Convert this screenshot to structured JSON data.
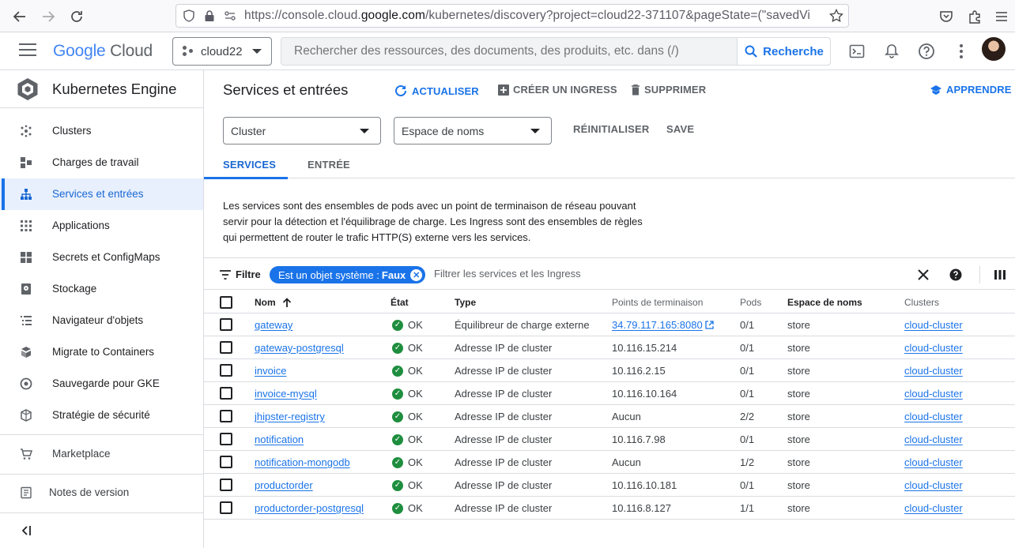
{
  "browser": {
    "url_prefix": "https://console.cloud.",
    "url_domain": "google.com",
    "url_rest": "/kubernetes/discovery?project=cloud22-371107&pageState=(\"savedVi"
  },
  "header": {
    "logo_google": "Google",
    "logo_cloud": "Cloud",
    "project": "cloud22",
    "search_placeholder": "Rechercher des ressources, des documents, des produits, etc. dans (/)",
    "search_button": "Recherche"
  },
  "sidebar": {
    "product": "Kubernetes Engine",
    "items": [
      {
        "label": "Clusters",
        "icon": "clusters-icon"
      },
      {
        "label": "Charges de travail",
        "icon": "workloads-icon"
      },
      {
        "label": "Services et entrées",
        "icon": "services-icon"
      },
      {
        "label": "Applications",
        "icon": "applications-icon"
      },
      {
        "label": "Secrets et ConfigMaps",
        "icon": "secrets-icon"
      },
      {
        "label": "Stockage",
        "icon": "storage-icon"
      },
      {
        "label": "Navigateur d'objets",
        "icon": "object-browser-icon"
      },
      {
        "label": "Migrate to Containers",
        "icon": "migrate-icon"
      },
      {
        "label": "Sauvegarde pour GKE",
        "icon": "backup-icon"
      },
      {
        "label": "Stratégie de sécurité",
        "icon": "security-icon"
      }
    ],
    "marketplace": "Marketplace",
    "release_notes": "Notes de version",
    "collapse": "<|"
  },
  "main": {
    "title": "Services et entrées",
    "refresh": "ACTUALISER",
    "create_ingress": "CRÉER UN INGRESS",
    "delete": "SUPPRIMER",
    "learn": "APPRENDRE",
    "cluster_dropdown": "Cluster",
    "namespace_dropdown": "Espace de noms",
    "reset": "RÉINITIALISER",
    "save": "SAVE",
    "tabs": [
      "SERVICES",
      "ENTRÉE"
    ],
    "description": "Les services sont des ensembles de pods avec un point de terminaison de réseau pouvant servir pour la détection et l'équilibrage de charge. Les Ingress sont des ensembles de règles qui permettent de router le trafic HTTP(S) externe vers les services.",
    "filter_label": "Filtre",
    "chip_key": "Est un objet système :",
    "chip_value": "Faux",
    "filter_placeholder": "Filtrer les services et les Ingress"
  },
  "table": {
    "columns": [
      "Nom",
      "État",
      "Type",
      "Points de terminaison",
      "Pods",
      "Espace de noms",
      "Clusters"
    ],
    "rows": [
      {
        "name": "gateway",
        "status": "OK",
        "type": "Équilibreur de charge externe",
        "endpoints": "34.79.117.165:8080",
        "pods": "0/1",
        "namespace": "store",
        "cluster": "cloud-cluster"
      },
      {
        "name": "gateway-postgresql",
        "status": "OK",
        "type": "Adresse IP de cluster",
        "endpoints": "10.116.15.214",
        "pods": "0/1",
        "namespace": "store",
        "cluster": "cloud-cluster"
      },
      {
        "name": "invoice",
        "status": "OK",
        "type": "Adresse IP de cluster",
        "endpoints": "10.116.2.15",
        "pods": "0/1",
        "namespace": "store",
        "cluster": "cloud-cluster"
      },
      {
        "name": "invoice-mysql",
        "status": "OK",
        "type": "Adresse IP de cluster",
        "endpoints": "10.116.10.164",
        "pods": "0/1",
        "namespace": "store",
        "cluster": "cloud-cluster"
      },
      {
        "name": "jhipster-registry",
        "status": "OK",
        "type": "Adresse IP de cluster",
        "endpoints": "Aucun",
        "pods": "2/2",
        "namespace": "store",
        "cluster": "cloud-cluster"
      },
      {
        "name": "notification",
        "status": "OK",
        "type": "Adresse IP de cluster",
        "endpoints": "10.116.7.98",
        "pods": "0/1",
        "namespace": "store",
        "cluster": "cloud-cluster"
      },
      {
        "name": "notification-mongodb",
        "status": "OK",
        "type": "Adresse IP de cluster",
        "endpoints": "Aucun",
        "pods": "1/2",
        "namespace": "store",
        "cluster": "cloud-cluster"
      },
      {
        "name": "productorder",
        "status": "OK",
        "type": "Adresse IP de cluster",
        "endpoints": "10.116.10.181",
        "pods": "0/1",
        "namespace": "store",
        "cluster": "cloud-cluster"
      },
      {
        "name": "productorder-postgresql",
        "status": "OK",
        "type": "Adresse IP de cluster",
        "endpoints": "10.116.8.127",
        "pods": "1/1",
        "namespace": "store",
        "cluster": "cloud-cluster"
      }
    ]
  },
  "colors": {
    "accent": "#1a73e8",
    "ok_green": "#1e8e3e",
    "active_bg": "#e8f0fe"
  }
}
